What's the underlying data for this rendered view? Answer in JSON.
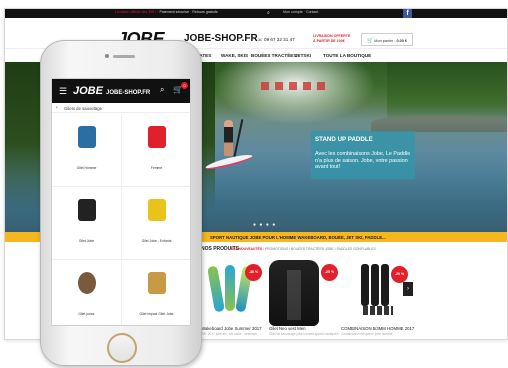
{
  "topbar": {
    "promo_red": "Livraison offerte dès 30€ !",
    "promo_rest": " · Paiement sécurisé · Retours gratuits",
    "links": "Mon compte · Contact",
    "search_icon": "search-icon",
    "facebook": "f"
  },
  "header": {
    "logo": "JOBE",
    "logo_suffix": "JOBE-SHOP.FR",
    "phone": "☏ 09 67 32 31 47",
    "promo_line1": "LIVRAISON OFFERTE",
    "promo_line2": "À PARTIR DE 100€",
    "cart_icon": "cart-icon",
    "cart_label": "Mon panier :",
    "cart_value": "0.00 €"
  },
  "nav": {
    "items": [
      "SKATES",
      "WAKE, SKIS",
      "BOUÉES TRACTÉES",
      "JETSKI",
      "TOUTE LA BOUTIQUE"
    ]
  },
  "hero": {
    "title": "STAND UP PADDLE",
    "text": "Avec les combinaisons Jobe, Le Paddle n'a plus de saison. Jobe, votre passion avant tout!",
    "dots": "● ● ● ●"
  },
  "banner": {
    "text": "SPORT NAUTIQUE JOBE POUR L'HOMME WAKEBOARD, BOUÉE, JET SKI, PADDLE..."
  },
  "products": {
    "heading": "NOS PRODUITS",
    "tabs_active": "LES NOUVEAUTÉS",
    "tabs_rest": "  /  PROMOTIONS  /  BOUÉES TRACTÉES JOBE  /  PADDLES GONFLABLES",
    "items": [
      {
        "title": "Wakeboard Jobe Summer 2017",
        "sub": "Réf. 2017 jobe ski · ski wake · sélection",
        "badge": "-30 %"
      },
      {
        "title": "Gilet Neo vest Men",
        "sub": "Gilet de sauvetage jobe homme sports nautiques",
        "badge": "-25 %"
      },
      {
        "title": "COMBINAISON 5/3MM HOMME 2017",
        "sub": "Combinaison néoprène jobe homme",
        "badge": "-20 %"
      }
    ],
    "arrow": "›"
  },
  "mobile": {
    "menu_icon": "menu-icon",
    "logo": "JOBE",
    "logo_suffix": "JOBE-SHOP.FR",
    "search_icon": "search-icon",
    "cart_icon": "cart-icon",
    "cart_count": "0",
    "back": "‹",
    "breadcrumb": "Gilets de sauvetage",
    "items": [
      {
        "label": "Gilet Homme",
        "color": "#2b6ea3"
      },
      {
        "label": "Femme",
        "color": "#e0212b"
      },
      {
        "label": "Gilet Jobe",
        "color": "#222222"
      },
      {
        "label": "Gilet Jobe - Enfants",
        "color": "#e8c31a"
      },
      {
        "label": "Gilet junior",
        "color": "#7a5a3c"
      },
      {
        "label": "Gilet impact Gilet Jobe",
        "color": "#c89a45"
      }
    ]
  },
  "colors": {
    "brand": "#111111",
    "accent": "#e0212b",
    "banner": "#f6b61e",
    "hero_overlay": "#3296aa"
  }
}
